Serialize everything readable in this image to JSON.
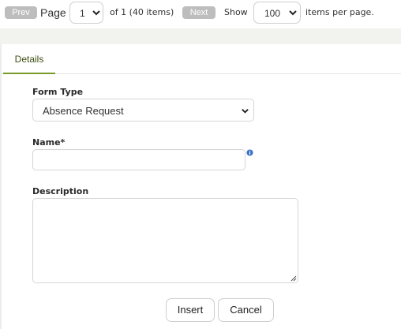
{
  "pager": {
    "prev_label": "Prev",
    "page_label": "Page",
    "page_value": "1",
    "of_text": "of 1 (40 items)",
    "next_label": "Next",
    "show_label": "Show",
    "page_size_value": "100",
    "per_page_text": "items per page."
  },
  "tabs": [
    {
      "label": "Details",
      "active": true
    }
  ],
  "form": {
    "form_type_label": "Form Type",
    "form_type_value": "Absence Request",
    "name_label": "Name*",
    "name_value": "",
    "description_label": "Description",
    "description_value": "",
    "insert_label": "Insert",
    "cancel_label": "Cancel"
  },
  "colors": {
    "accent": "#7a9a2a",
    "pager_button": "#bdbdbd",
    "info_icon": "#3a6fc4"
  },
  "icons": {
    "select_chevron": "chevron-down-icon",
    "info": "info-icon",
    "resize": "resize-grip-icon"
  }
}
